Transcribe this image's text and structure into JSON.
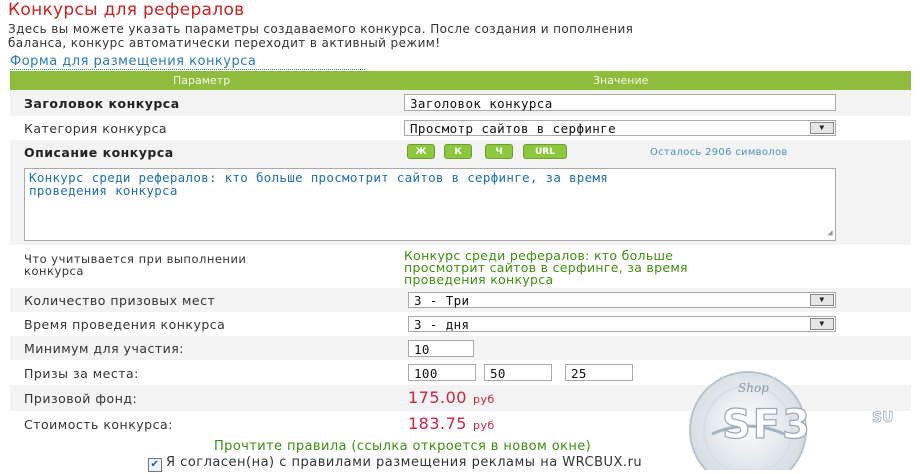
{
  "page": {
    "title": "Конкурсы для рефералов",
    "intro_line1": "Здесь вы можете указать параметры создаваемого конкурса. После создания и пополнения",
    "intro_line2": "баланса, конкурс автоматически переходит в активный режим!",
    "form_title": "Форма для размещения конкурса"
  },
  "table": {
    "header_param": "Параметр",
    "header_value": "Значение"
  },
  "fields": {
    "title_label": "Заголовок конкурса",
    "title_value": "Заголовок конкурса",
    "category_label": "Категория конкурса",
    "category_value": "Просмотр сайтов в серфинге",
    "description_label": "Описание конкурса",
    "format_buttons": [
      "Ж",
      "К",
      "Ч",
      "URL"
    ],
    "chars_left": "Осталось 2906 символов",
    "description_line1": "Конкурс среди рефералов: кто больше просмотрит сайтов в серфинге, за время",
    "description_line2": "проведения конкурса",
    "counted_label_line1": "Что учитывается при выполнении",
    "counted_label_line2": "конкурса",
    "counted_value_line1": "Конкурс среди рефералов: кто больше",
    "counted_value_line2": "просмотрит сайтов в серфинге, за время",
    "counted_value_line3": "проведения конкурса",
    "places_label": "Количество призовых мест",
    "places_value": "3 - Три",
    "duration_label": "Время проведения конкурса",
    "duration_value": "3 - дня",
    "minimum_label": "Минимум для участия:",
    "minimum_value": "10",
    "prizes_label": "Призы за места:",
    "prize_values": [
      "100",
      "50",
      "25"
    ],
    "fund_label": "Призовой фонд:",
    "fund_value": "175.00",
    "fund_unit": "руб",
    "cost_label": "Стоимость конкурса:",
    "cost_value": "183.75",
    "cost_unit": "руб"
  },
  "footer": {
    "rules_link": "Прочтите правила (ссылка откроется в новом окне)",
    "agree_text": "Я согласен(на) с правилами размещения рекламы на WRCBUX.ru",
    "agree_checked": true
  },
  "watermark": {
    "top_text": "Shop",
    "logo_text": "SF3",
    "suffix": "SU"
  },
  "colors": {
    "title_red": "#cc2222",
    "header_green": "#8fbc3c",
    "link_blue": "#2a7ab5",
    "value_green": "#3d8f0f",
    "price_red": "#cc2244"
  }
}
